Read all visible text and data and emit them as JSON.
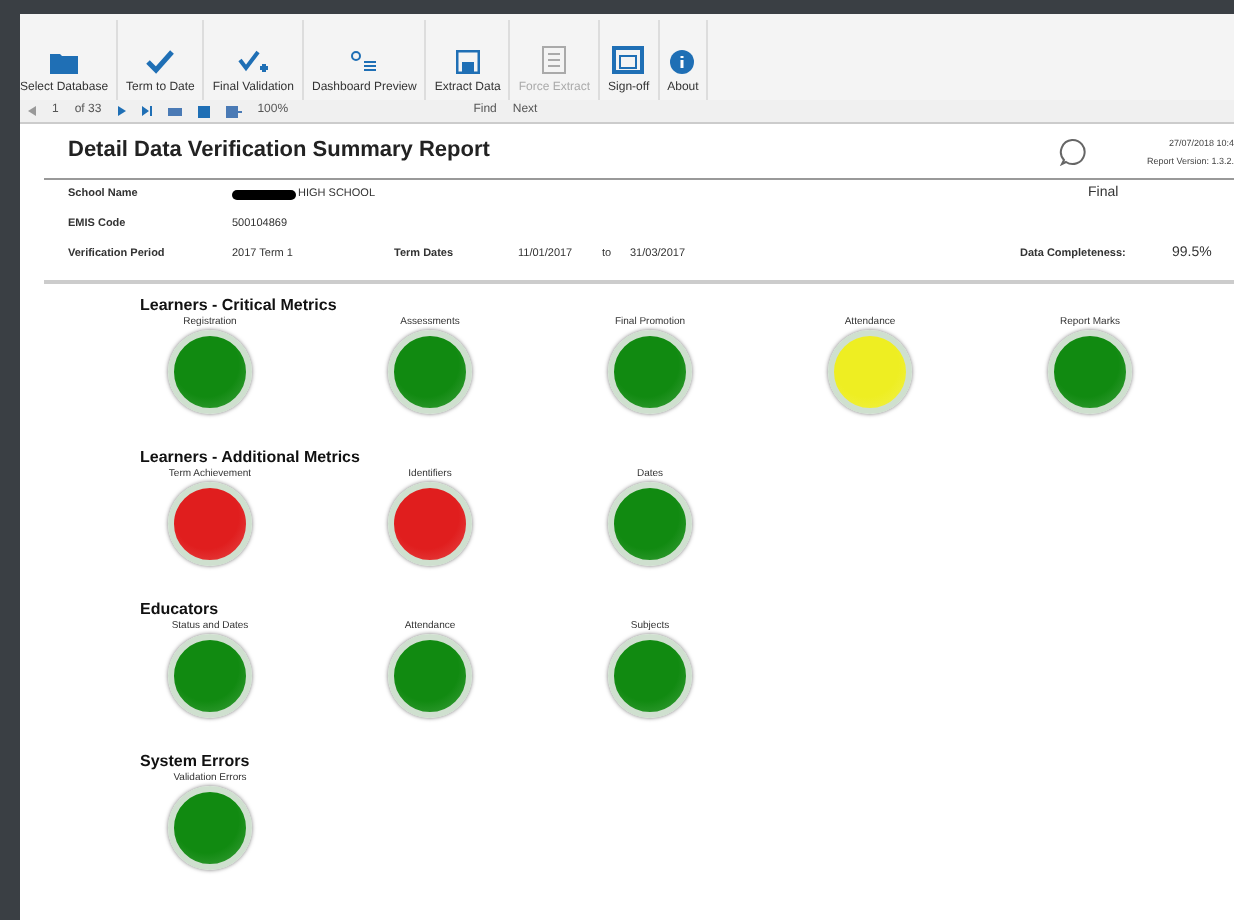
{
  "toolbar": [
    {
      "label": "Select Database",
      "disabled": false
    },
    {
      "label": "Term to Date",
      "disabled": false
    },
    {
      "label": "Final Validation",
      "disabled": false
    },
    {
      "label": "Dashboard Preview",
      "disabled": false
    },
    {
      "label": "Extract Data",
      "disabled": false
    },
    {
      "label": "Force Extract",
      "disabled": true
    },
    {
      "label": "Sign-off",
      "disabled": false
    },
    {
      "label": "About",
      "disabled": false
    }
  ],
  "navbar": {
    "page": "1",
    "page_count": "of 33",
    "zoom": "100%",
    "find": "Find",
    "next": "Next"
  },
  "report": {
    "title": "Detail Data Verification Summary Report",
    "timestamp": "27/07/2018 10:4",
    "version": "Report Version: 1.3.2.",
    "fields": {
      "school_label": "School Name",
      "school_value": "HIGH SCHOOL",
      "status": "Final",
      "emis_label": "EMIS Code",
      "emis_value": "500104869",
      "period_label": "Verification Period",
      "period_value": "2017 Term 1",
      "dates_label": "Term Dates",
      "date_from": "11/01/2017",
      "to": "to",
      "date_to": "31/03/2017",
      "completeness_label": "Data Completeness:",
      "completeness_value": "99.5%"
    },
    "sections": [
      {
        "title": "Learners - Critical Metrics",
        "metrics": [
          {
            "label": "Registration",
            "color": "#118a11"
          },
          {
            "label": "Assessments",
            "color": "#118a11"
          },
          {
            "label": "Final Promotion",
            "color": "#118a11"
          },
          {
            "label": "Attendance",
            "color": "#eeee22"
          },
          {
            "label": "Report Marks",
            "color": "#118a11"
          }
        ]
      },
      {
        "title": "Learners - Additional Metrics",
        "metrics": [
          {
            "label": "Term Achievement",
            "color": "#e01e1e"
          },
          {
            "label": "Identifiers",
            "color": "#e01e1e"
          },
          {
            "label": "Dates",
            "color": "#118a11"
          }
        ]
      },
      {
        "title": "Educators",
        "metrics": [
          {
            "label": "Status and Dates",
            "color": "#118a11"
          },
          {
            "label": "Attendance",
            "color": "#118a11"
          },
          {
            "label": "Subjects",
            "color": "#118a11"
          }
        ]
      },
      {
        "title": "System Errors",
        "metrics": [
          {
            "label": "Validation Errors",
            "color": "#118a11"
          }
        ]
      }
    ]
  }
}
